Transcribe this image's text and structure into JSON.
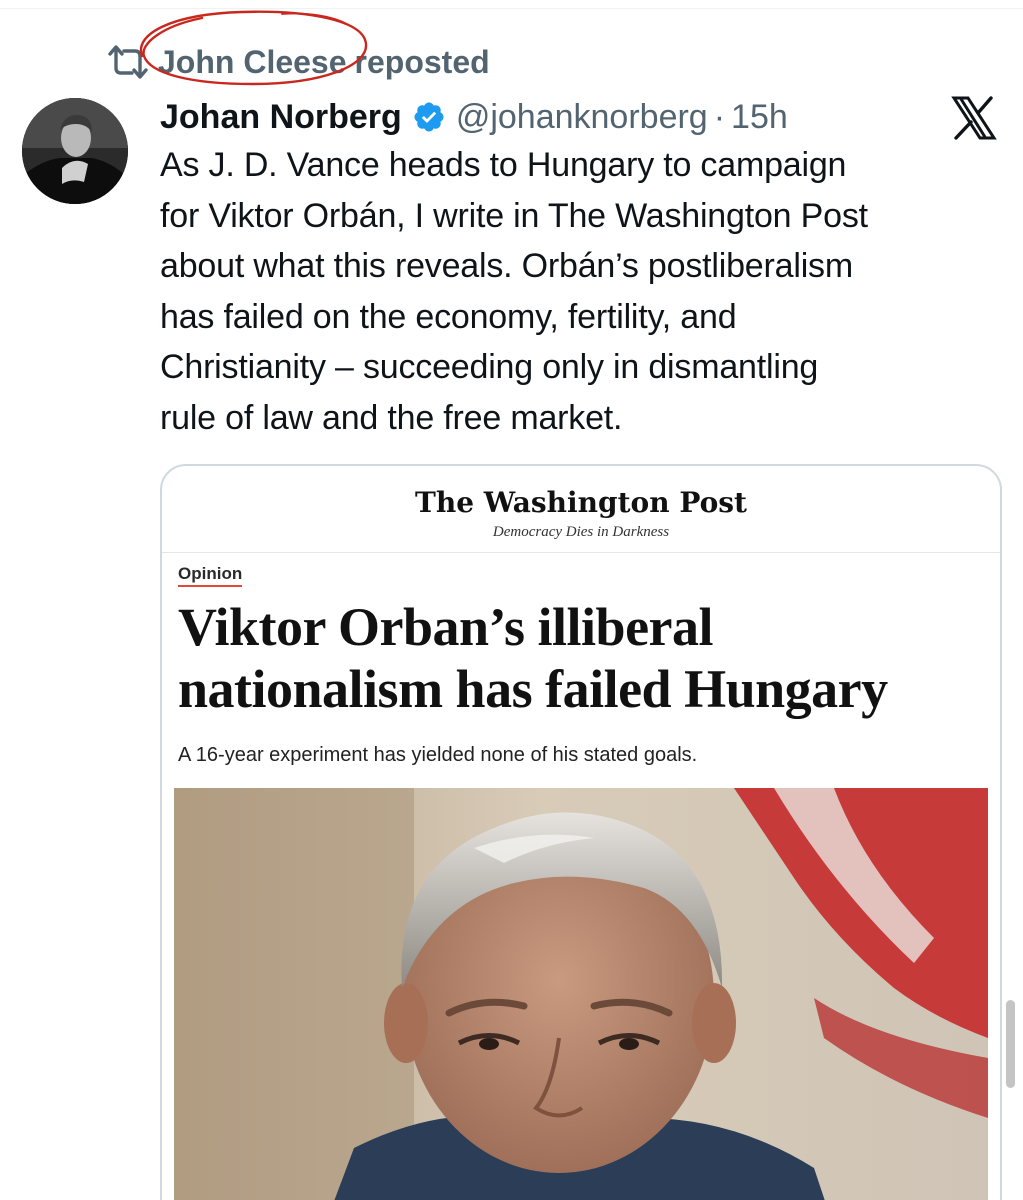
{
  "repost": {
    "reposter_name": "John Cleese",
    "suffix": "reposted",
    "icon": "repost-icon"
  },
  "tweet": {
    "author_name": "Johan Norberg",
    "verified_icon": "verified-badge-icon",
    "handle": "@johanknorberg",
    "separator": "·",
    "time": "15h",
    "platform_logo": "x-logo-icon",
    "text_lines": [
      "As J. D. Vance heads to Hungary to campaign",
      "for Viktor Orbán, I write in The Washington Post",
      "about what this reveals. Orbán’s postliberalism",
      "has failed on the economy, fertility, and",
      "Christianity – succeeding only in dismantling",
      "rule of law and the free market."
    ]
  },
  "card": {
    "masthead": "The Washington Post",
    "tagline": "Democracy Dies in Darkness",
    "section": "Opinion",
    "headline_lines": [
      "Viktor Orban’s illiberal",
      "nationalism has failed Hungary"
    ],
    "subheadline": "A 16-year experiment has yielded none of his stated goals."
  },
  "colors": {
    "secondary_text": "#536471",
    "verified_blue": "#1d9bf0",
    "annotation_red": "#c8281e",
    "card_border": "#cfd9de"
  }
}
